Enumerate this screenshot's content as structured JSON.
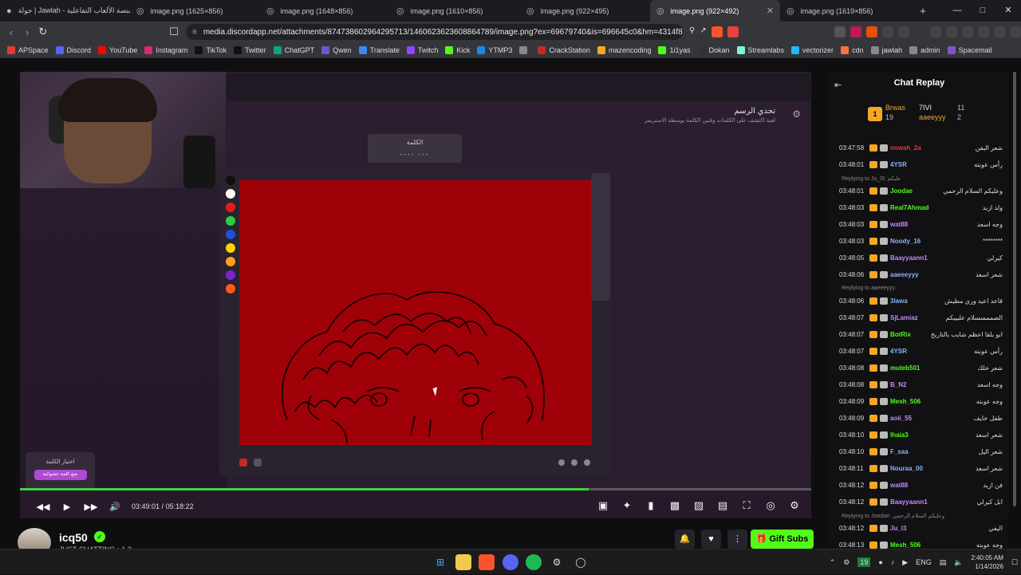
{
  "tabs": [
    {
      "label": "جولة | Jawlah - منصة الألعاب التفاعلية",
      "active": false
    },
    {
      "label": "image.png (1625×856)",
      "active": false
    },
    {
      "label": "image.png (1648×856)",
      "active": false
    },
    {
      "label": "image.png (1610×856)",
      "active": false
    },
    {
      "label": "image.png (922×495)",
      "active": false
    },
    {
      "label": "image.png (922×492)",
      "active": true
    },
    {
      "label": "image.png (1619×856)",
      "active": false
    }
  ],
  "address": {
    "url": "media.discordapp.net/attachments/874738602964295713/1460623623608864789/image.png?ex=69679740&is=696645c0&hm=4314f829ac40..."
  },
  "bookmarks": [
    {
      "label": "APSpace",
      "color": "#e53935"
    },
    {
      "label": "Discord",
      "color": "#5865f2"
    },
    {
      "label": "YouTube",
      "color": "#ff0000"
    },
    {
      "label": "Instagram",
      "color": "#d62976"
    },
    {
      "label": "TikTok",
      "color": "#111111"
    },
    {
      "label": "Twitter",
      "color": "#111111"
    },
    {
      "label": "ChatGPT",
      "color": "#10a37f"
    },
    {
      "label": "Qwen",
      "color": "#6a5acd"
    },
    {
      "label": "Translate",
      "color": "#4285f4"
    },
    {
      "label": "Twitch",
      "color": "#9146ff"
    },
    {
      "label": "Kick",
      "color": "#53fc18"
    },
    {
      "label": "YTMP3",
      "color": "#1e88e5"
    },
    {
      "label": "",
      "color": "#888888"
    },
    {
      "label": "CrackStation",
      "color": "#c62828"
    },
    {
      "label": "mazencoding",
      "color": "#f9a825"
    },
    {
      "label": "1i1yas",
      "color": "#53fc18"
    },
    {
      "label": "Dokan",
      "color": "#333333"
    },
    {
      "label": "Streamlabs",
      "color": "#80f5d2"
    },
    {
      "label": "vectorizer",
      "color": "#29b6f6"
    },
    {
      "label": "cdn",
      "color": "#ff7043"
    },
    {
      "label": "jawlah",
      "color": "#888888"
    },
    {
      "label": "admin",
      "color": "#888888"
    },
    {
      "label": "Spacemail",
      "color": "#7e57c2"
    }
  ],
  "game": {
    "title": "تحدي الرسم",
    "subtitle": "لعبة اكتشف على الكلمات وقتين الكلمة يوسطة الاستريمر",
    "word_label": "الكلمة",
    "word_mask": "---- ---",
    "choose_word": "اختيار الكلمة",
    "random_word": "ضع كلمة عشوائية",
    "palette": [
      "#111111",
      "#ffffff",
      "#e31b1b",
      "#2ecc40",
      "#1d4fd8",
      "#ffd500",
      "#ff9f1a",
      "#7e22ce",
      "#ff5a1f"
    ],
    "canvas_color": "#a00008"
  },
  "player": {
    "time_current": "03:49:01",
    "time_total": "05:18:22",
    "progress": 0.719
  },
  "channel": {
    "name": "icq50",
    "subtitle": "JUST CHATTING • 1.2",
    "gift_label": "Gift Subs"
  },
  "chat": {
    "title": "Chat Replay",
    "top": [
      {
        "rank": "1",
        "name": "Brwas",
        "count": "19"
      },
      {
        "name": "7IVI",
        "count": "11"
      },
      {
        "name": "aaeeyyy",
        "count": "2"
      }
    ],
    "messages": [
      {
        "ts": "03:47:58",
        "user": "nowah_2a",
        "color": "#e53935",
        "text": "شعر اليفن"
      },
      {
        "ts": "03:48:01",
        "user": "4YSR",
        "color": "#8ab4f8",
        "text": "رأس عوبته"
      },
      {
        "ts": "03:48:01",
        "user": "Joodae",
        "color": "#53fc18",
        "text": "وعليكم السلام الرحمي",
        "reply": "Replying to Ju_l3: عليكم"
      },
      {
        "ts": "03:48:03",
        "user": "Real7Ahmad",
        "color": "#53fc18",
        "text": "ولد ازيد"
      },
      {
        "ts": "03:48:03",
        "user": "wat88",
        "color": "#c58af9",
        "text": "وجه اسعد"
      },
      {
        "ts": "03:48:03",
        "user": "Noody_16",
        "color": "#8ab4f8",
        "text": "********"
      },
      {
        "ts": "03:48:05",
        "user": "Baayyaann1",
        "color": "#c58af9",
        "text": "كيرلي"
      },
      {
        "ts": "03:48:06",
        "user": "aaeeeyyy",
        "color": "#8ab4f8",
        "text": "شعر اسعد"
      },
      {
        "ts": "03:48:06",
        "user": "3lawa",
        "color": "#8ab4f8",
        "text": "قاعد اعيد وري مطيش",
        "reply": "Replying to aaeeeyyy:"
      },
      {
        "ts": "03:48:07",
        "user": "SjLamiaz",
        "color": "#c58af9",
        "text": "الصممسسلام عليييكم"
      },
      {
        "ts": "03:48:07",
        "user": "BotRix",
        "color": "#53fc18",
        "text": "ابو بلقا اعظم شايب بالتاريخ"
      },
      {
        "ts": "03:48:07",
        "user": "4YSR",
        "color": "#8ab4f8",
        "text": "رأس عوبته"
      },
      {
        "ts": "03:48:08",
        "user": "muteb501",
        "color": "#53fc18",
        "text": "شعر خلك"
      },
      {
        "ts": "03:48:08",
        "user": "B_N2",
        "color": "#c58af9",
        "text": "وجه اسعد"
      },
      {
        "ts": "03:48:09",
        "user": "Mesh_506",
        "color": "#53fc18",
        "text": "وجه عوبته"
      },
      {
        "ts": "03:48:09",
        "user": "aoii_55",
        "color": "#c58af9",
        "text": "طفل خايف"
      },
      {
        "ts": "03:48:10",
        "user": "lhaia3",
        "color": "#53fc18",
        "text": "شعر اسعد"
      },
      {
        "ts": "03:48:10",
        "user": "F_saa",
        "color": "#8ab4f8",
        "text": "شعر اليل"
      },
      {
        "ts": "03:48:11",
        "user": "Nouraa_00",
        "color": "#8ab4f8",
        "text": "شعر اسعد"
      },
      {
        "ts": "03:48:12",
        "user": "wat88",
        "color": "#c58af9",
        "text": "فن ازيد"
      },
      {
        "ts": "03:48:12",
        "user": "Baayyaann1",
        "color": "#c58af9",
        "text": "ابل كيرلي"
      },
      {
        "ts": "03:48:12",
        "user": "Ju_l3",
        "color": "#c58af9",
        "text": "اليفي",
        "reply": "Replying to Joodae: وعليكم السلام الرحمي"
      },
      {
        "ts": "03:48:13",
        "user": "Mesh_506",
        "color": "#53fc18",
        "text": "وجه عوبته"
      }
    ]
  },
  "taskbar": {
    "lang": "ENG",
    "time": "2:40:05 AM",
    "date": "1/14/2026"
  }
}
